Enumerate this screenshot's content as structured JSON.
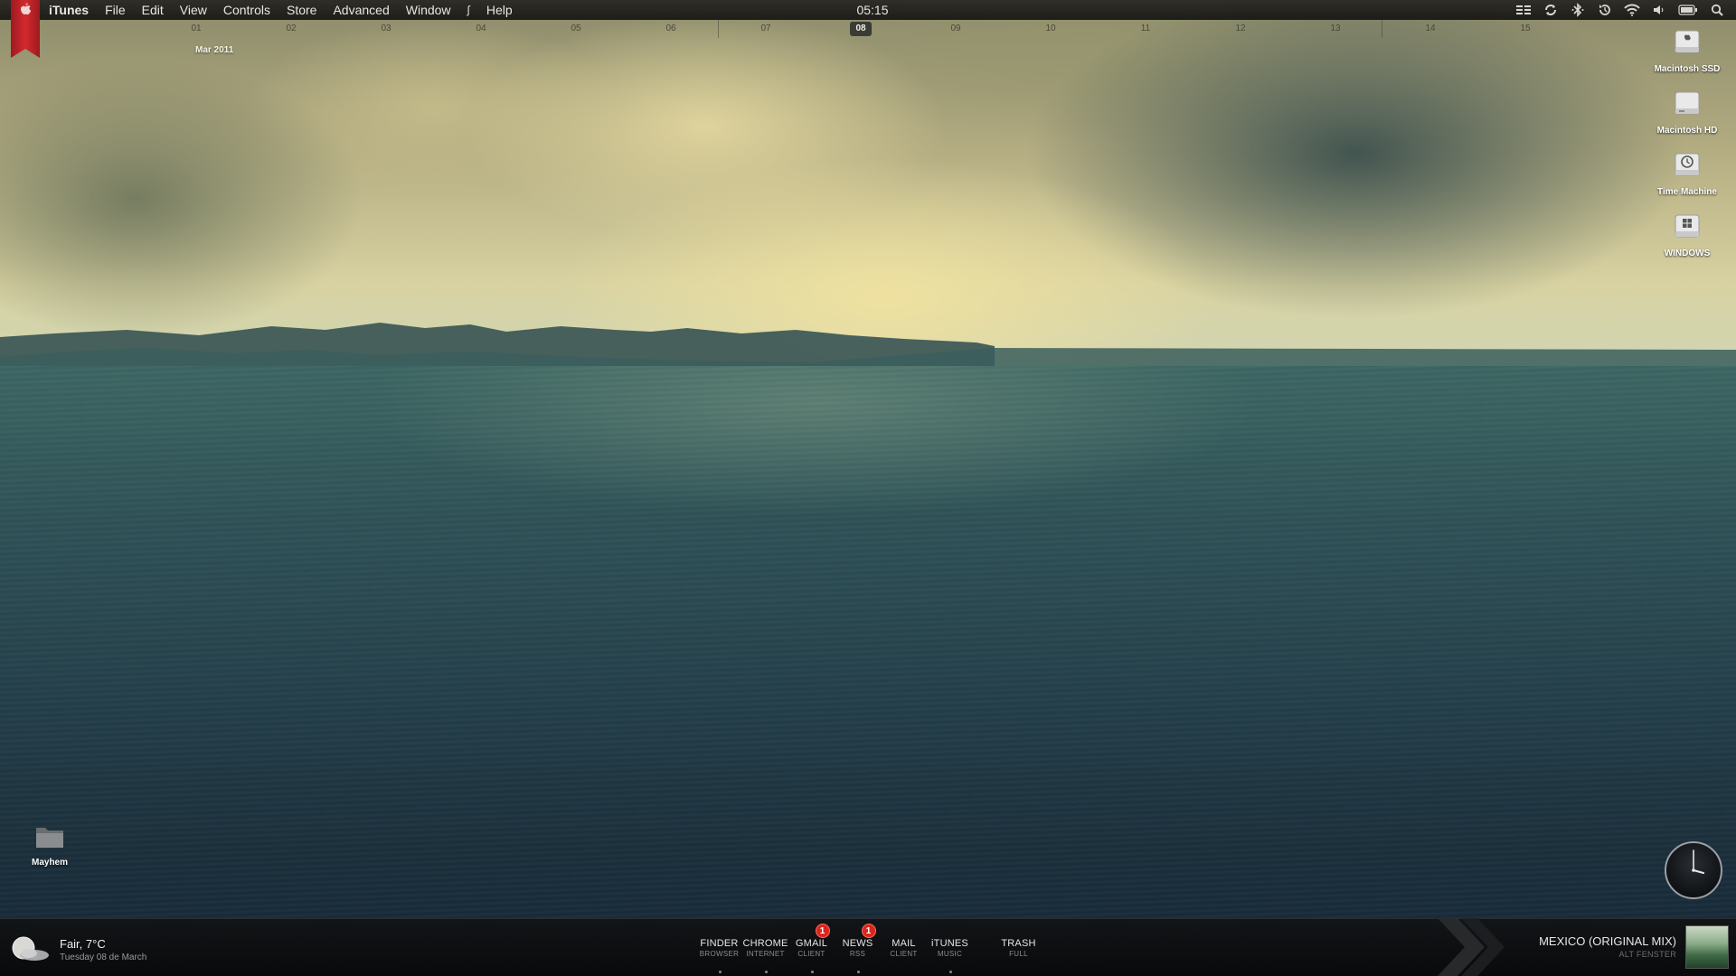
{
  "menubar": {
    "app_name": "iTunes",
    "items": [
      "File",
      "Edit",
      "View",
      "Controls",
      "Store",
      "Advanced",
      "Window",
      "Help"
    ],
    "clock": "05:15",
    "status_icons": [
      "list-icon",
      "sync-icon",
      "bluetooth-icon",
      "time-machine-icon",
      "wifi-icon",
      "volume-icon",
      "battery-icon",
      "spotlight-icon"
    ]
  },
  "calendar": {
    "days": [
      "01",
      "02",
      "03",
      "04",
      "05",
      "06",
      "07",
      "08",
      "09",
      "10",
      "11",
      "12",
      "13",
      "14",
      "15"
    ],
    "today": "08",
    "month_label": "Mar 2011"
  },
  "desktop": {
    "drives": [
      {
        "label": "Macintosh SSD",
        "icon": "hard-drive-icon"
      },
      {
        "label": "Macintosh HD",
        "icon": "hard-drive-icon"
      },
      {
        "label": "Time Machine",
        "icon": "time-machine-icon"
      },
      {
        "label": "WINDOWS",
        "icon": "windows-drive-icon"
      }
    ],
    "folder": {
      "label": "Mayhem",
      "icon": "folder-icon"
    }
  },
  "weather": {
    "condition": "Fair, 7°C",
    "date": "Tuesday 08 de March",
    "icon": "moon-cloud-icon"
  },
  "dock": {
    "items": [
      {
        "title": "FINDER",
        "subtitle": "BROWSER",
        "badge": ""
      },
      {
        "title": "CHROME",
        "subtitle": "INTERNET",
        "badge": ""
      },
      {
        "title": "GMAIL",
        "subtitle": "CLIENT",
        "badge": "1"
      },
      {
        "title": "NEWS",
        "subtitle": "RSS",
        "badge": "1"
      },
      {
        "title": "MAIL",
        "subtitle": "CLIENT",
        "badge": ""
      },
      {
        "title": "iTUNES",
        "subtitle": "MUSIC",
        "badge": ""
      },
      {
        "title": "TRASH",
        "subtitle": "FULL",
        "badge": ""
      }
    ]
  },
  "now_playing": {
    "title": "MEXICO (ORIGINAL MIX)",
    "artist": "ALT FENSTER"
  },
  "colors": {
    "badge": "#d9261c",
    "ribbon": "#c8252a",
    "menubar_text": "#e8e6df"
  }
}
